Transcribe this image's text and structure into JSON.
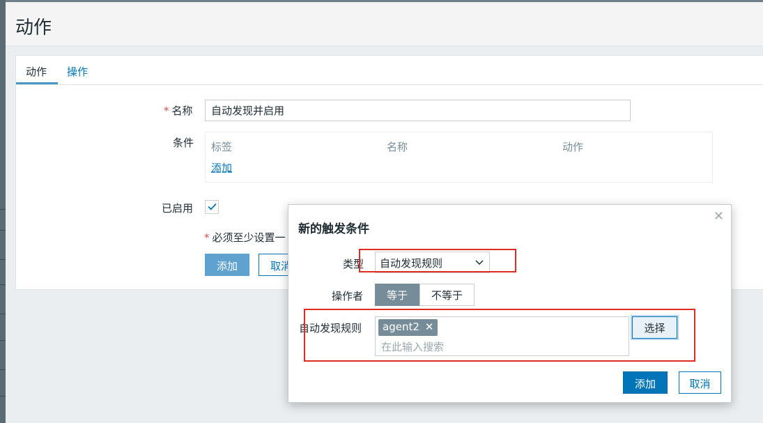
{
  "page": {
    "title": "动作"
  },
  "tabs": [
    {
      "label": "动作",
      "active": true
    },
    {
      "label": "操作",
      "active": false
    }
  ],
  "form": {
    "name_label": "名称",
    "name_value": "自动发现并启用",
    "conditions_label": "条件",
    "conditions_headers": [
      "标签",
      "名称",
      "动作"
    ],
    "conditions_add": "添加",
    "enabled_label": "已启用",
    "enabled": true,
    "note": "必须至少设置一",
    "add_button": "添加",
    "cancel_button": "取消"
  },
  "modal": {
    "title": "新的触发条件",
    "type_label": "类型",
    "type_value": "自动发现规则",
    "operator_label": "操作者",
    "operator_options": [
      "等于",
      "不等于"
    ],
    "operator_selected": "等于",
    "rule_label": "自动发现规则",
    "rule_tags": [
      "agent2"
    ],
    "rule_placeholder": "在此输入搜索",
    "select_button": "选择",
    "add_button": "添加",
    "cancel_button": "取消"
  },
  "colors": {
    "accent": "#0275b8",
    "highlight": "#e22b24",
    "tag_bg": "#768d99"
  }
}
